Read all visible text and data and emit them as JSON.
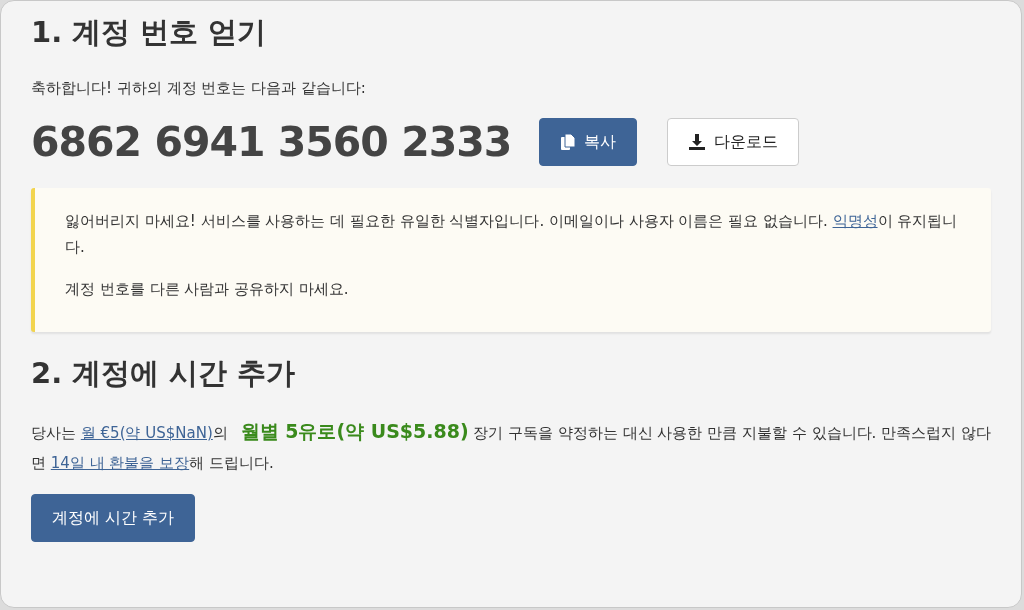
{
  "sections": [
    {
      "title": "1. 계정 번호 얻기",
      "intro": "축하합니다! 귀하의 계정 번호는 다음과 같습니다:",
      "account_number": "6862 6941 3560 2333",
      "buttons": [
        {
          "kind": "copy",
          "label": "복사"
        },
        {
          "kind": "download",
          "label": "다운로드"
        }
      ],
      "notice": [
        [
          {
            "kind": "text",
            "text": "잃어버리지 마세요! 서비스를 사용하는 데 필요한 유일한 식별자입니다. 이메일이나 사용자 이름은 필요 없습니다. "
          },
          {
            "kind": "link",
            "text": "익명성"
          },
          {
            "kind": "text",
            "text": "이 유지됩니다."
          }
        ],
        [
          {
            "kind": "text",
            "text": "계정 번호를 다른 사람과 공유하지 마세요."
          }
        ]
      ]
    },
    {
      "title": "2. 계정에 시간 추가",
      "paragraph": [
        {
          "kind": "text",
          "text": "당사는 "
        },
        {
          "kind": "link",
          "text": "월 €5(약 US$NaN)"
        },
        {
          "kind": "text",
          "text": "의 "
        },
        {
          "kind": "price",
          "text": "월별 5유로(약 US$5.88)"
        },
        {
          "kind": "text",
          "text": " 장기 구독을 약정하는 대신 사용한 만큼 지불할 수 있습니다. 만족스럽지 않다면 "
        },
        {
          "kind": "link",
          "text": "14일 내 환불을 보장"
        },
        {
          "kind": "text",
          "text": "해 드립니다."
        }
      ],
      "buttons": [
        {
          "kind": "add",
          "label": "계정에 시간 추가"
        }
      ]
    }
  ]
}
